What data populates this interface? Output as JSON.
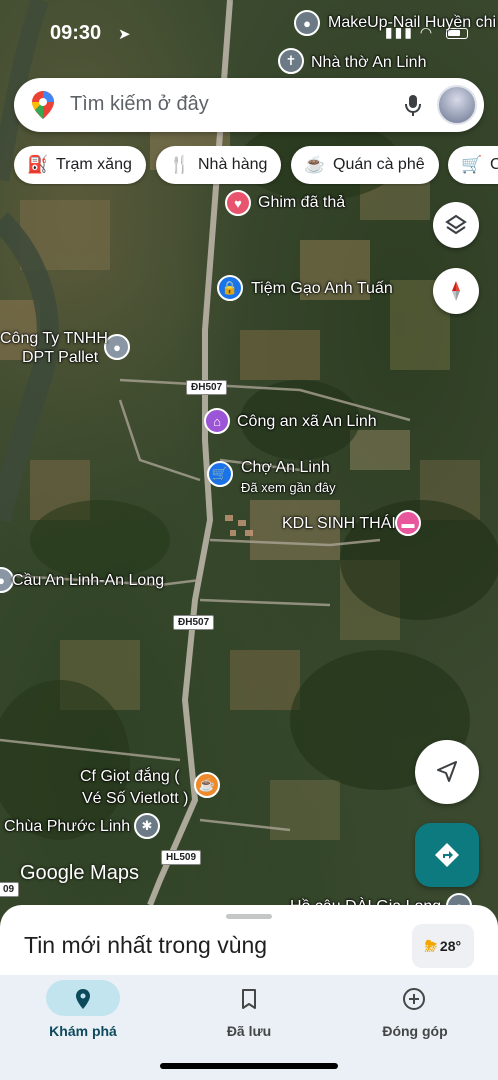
{
  "status_bar": {
    "time": "09:30"
  },
  "search": {
    "placeholder": "Tìm kiếm ở đây"
  },
  "chips": [
    {
      "label": "Trạm xăng",
      "icon": "gas-station-icon"
    },
    {
      "label": "Nhà hàng",
      "icon": "restaurant-icon"
    },
    {
      "label": "Quán cà phê",
      "icon": "coffee-icon"
    },
    {
      "label": "C",
      "icon": "shopping-cart-icon"
    }
  ],
  "map_labels": {
    "makeup": "MakeUp-Nail Huyền chi",
    "church": "Nhà thờ An Linh",
    "pin": "Ghim đã thả",
    "rice": "Tiệm Gạo Anh Tuấn",
    "company_line1": "Công Ty TNHH",
    "company_line2": "DPT Pallet",
    "police": "Công an xã An Linh",
    "market": "Chợ An Linh",
    "market_sub": "Đã xem gần đây",
    "resort": "KDL SINH THÁI",
    "bridge": "Cầu An Linh-An Long",
    "cafe_line1": "Cf Giọt đắng (",
    "cafe_line2": "Vé Số Vietlott )",
    "pagoda": "Chùa Phước Linh",
    "bottom_place": "Hồ câu DÀI Gia Long",
    "road1": "ĐH507",
    "road2": "ĐH507",
    "road3": "HL509",
    "road4": "09",
    "logo": "Google Maps"
  },
  "sheet": {
    "title": "Tin mới nhất trong vùng",
    "temperature": "28°"
  },
  "nav": [
    {
      "label": "Khám phá",
      "active": true
    },
    {
      "label": "Đã lưu",
      "active": false
    },
    {
      "label": "Đóng góp",
      "active": false
    }
  ],
  "colors": {
    "accent": "#0c7a7e",
    "nav_bg": "#eaf0f6",
    "nav_pill": "#c2e4ef"
  }
}
